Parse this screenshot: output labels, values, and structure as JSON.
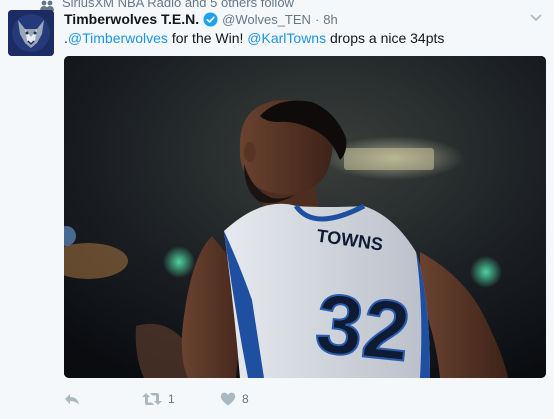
{
  "context": {
    "text": "SiriusXM NBA Radio and 5 others follow"
  },
  "tweet": {
    "display_name": "Timberwolves T.E.N.",
    "handle": "@Wolves_TEN",
    "separator": "·",
    "timestamp": "8h",
    "text_prefix": ".",
    "mention_1": "@Timberwolves",
    "text_middle": " for the Win! ",
    "mention_2": "@KarlTowns",
    "text_suffix": " drops a nice 34pts"
  },
  "media": {
    "jersey_name": "TOWNS",
    "jersey_number": "32"
  },
  "actions": {
    "reply_count": "",
    "retweet_count": "1",
    "like_count": "8"
  },
  "colors": {
    "link": "#1b95e0",
    "muted": "#657786",
    "verified": "#1da1f2"
  }
}
